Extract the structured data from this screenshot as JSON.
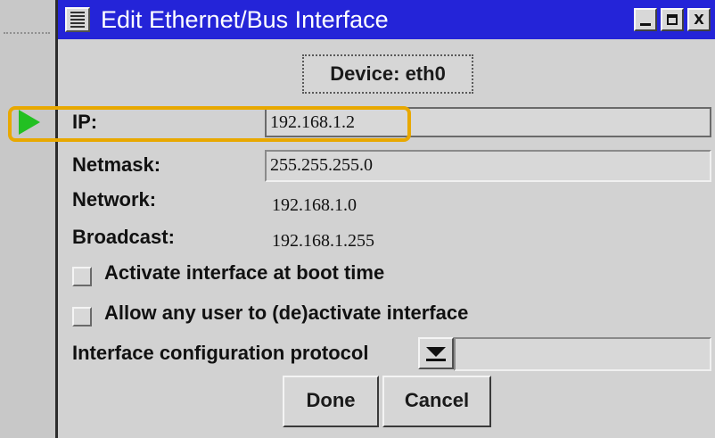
{
  "window": {
    "title": "Edit Ethernet/Bus Interface",
    "controls": [
      "minimize",
      "maximize",
      "close"
    ],
    "close_glyph": "X"
  },
  "device": {
    "label": "Device: eth0"
  },
  "fields": {
    "ip": {
      "label": "IP:",
      "value": "192.168.1.2"
    },
    "netmask": {
      "label": "Netmask:",
      "value": "255.255.255.0"
    },
    "network": {
      "label": "Network:",
      "value": "192.168.1.0"
    },
    "broadcast": {
      "label": "Broadcast:",
      "value": "192.168.1.255"
    }
  },
  "options": {
    "activate_at_boot": {
      "label": "Activate interface at boot time",
      "checked": false
    },
    "allow_any_user": {
      "label": "Allow any user to (de)activate interface",
      "checked": false
    }
  },
  "protocol": {
    "label": "Interface configuration protocol",
    "value": ""
  },
  "buttons": {
    "done": "Done",
    "cancel": "Cancel"
  },
  "colors": {
    "titlebar": "#2424d8",
    "highlight": "#e8a800",
    "pointer_arrow": "#22c022"
  }
}
